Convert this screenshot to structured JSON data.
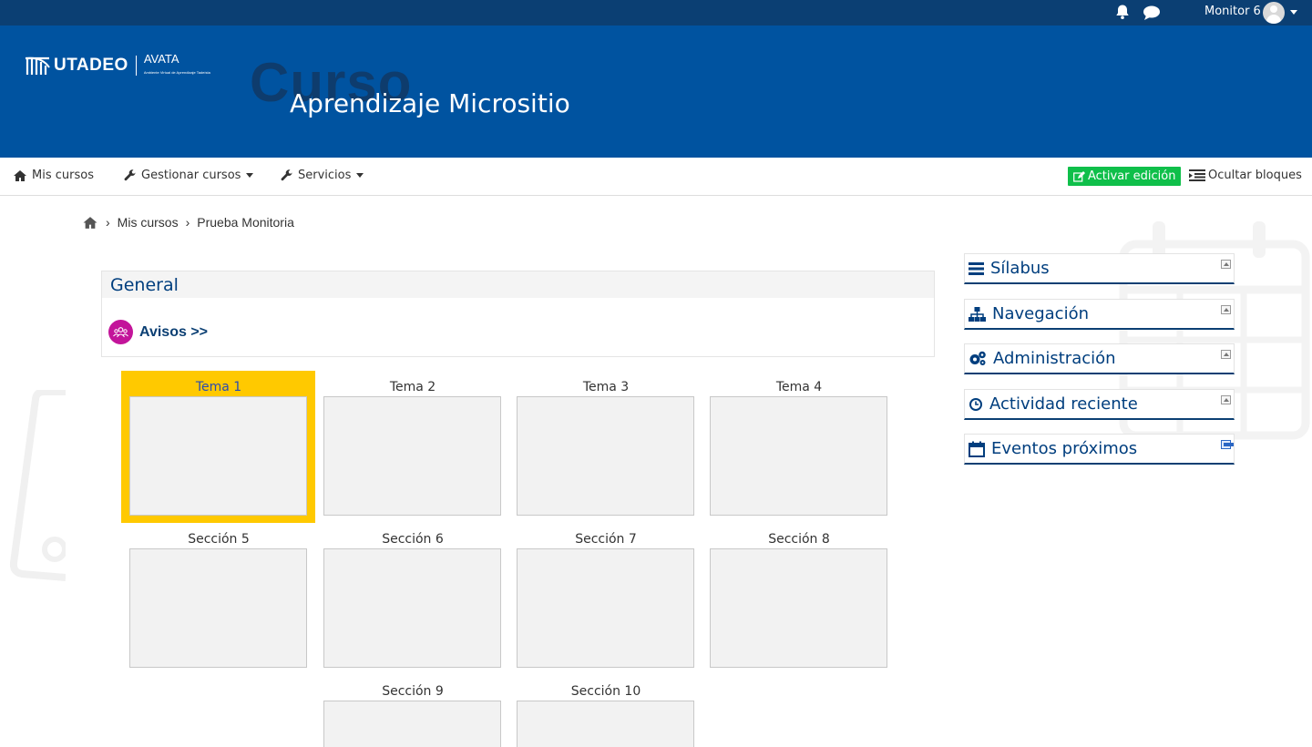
{
  "topbar": {
    "username": "Monitor 6",
    "icons": [
      "bell-icon",
      "chat-icon",
      "avatar",
      "chevron-down-icon"
    ]
  },
  "banner": {
    "logo_brand": "UTADEO",
    "logo_product": "AVATA",
    "logo_product_sub": "Ambiente Virtual de Aprendizaje Tadeísta",
    "watermark": "Curso",
    "title": "Aprendizaje Micrositio",
    "bg_color": "#0053a0"
  },
  "nav": {
    "my_courses": "Mis cursos",
    "manage_courses": "Gestionar cursos",
    "services": "Servicios",
    "edit_button": "Activar edición",
    "hide_blocks": "Ocultar bloques",
    "edit_button_color": "#0fbf4a"
  },
  "breadcrumb": {
    "items": [
      "Mis cursos",
      "Prueba Monitoria"
    ]
  },
  "general": {
    "heading": "General",
    "avisos_label": "Avisos >>",
    "avisos_icon_color": "#c3149a"
  },
  "tiles": [
    {
      "label": "Tema 1",
      "active": true
    },
    {
      "label": "Tema 2",
      "active": false
    },
    {
      "label": "Tema 3",
      "active": false
    },
    {
      "label": "Tema 4",
      "active": false
    },
    {
      "label": "Sección 5",
      "active": false
    },
    {
      "label": "Sección 6",
      "active": false
    },
    {
      "label": "Sección 7",
      "active": false
    },
    {
      "label": "Sección 8",
      "active": false
    },
    {
      "label": "Sección 9",
      "active": false
    },
    {
      "label": "Sección 10",
      "active": false
    }
  ],
  "highlight_color": "#ffc900",
  "blocks": [
    {
      "title": "Sílabus",
      "icon": "list-icon"
    },
    {
      "title": "Navegación",
      "icon": "sitemap-icon"
    },
    {
      "title": "Administración",
      "icon": "cogs-icon"
    },
    {
      "title": "Actividad reciente",
      "icon": "clock-icon"
    },
    {
      "title": "Eventos próximos",
      "icon": "calendar-icon"
    }
  ]
}
